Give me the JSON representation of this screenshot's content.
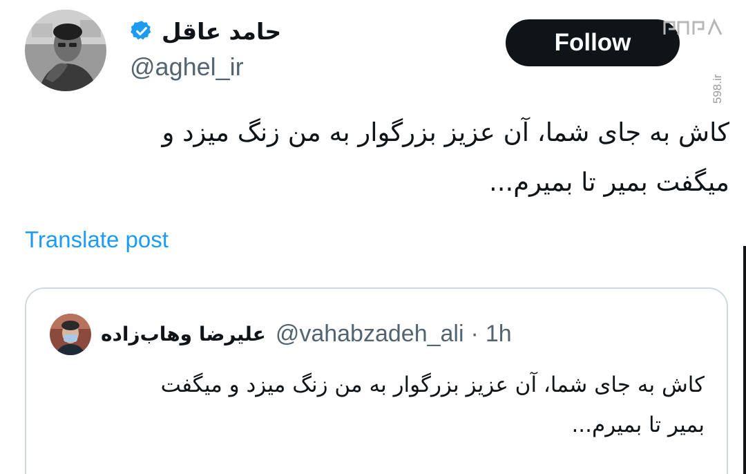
{
  "author": {
    "display_name": "حامد عاقل",
    "handle": "@aghel_ir",
    "verified": true,
    "avatar_icon": "avatar-photo-icon",
    "verified_icon": "verified-badge-icon"
  },
  "follow_button": {
    "label": "Follow"
  },
  "post": {
    "text_line1": "کاش به جای شما، آن عزیز بزرگوار به من زنگ میزد و",
    "text_line2": "میگفت بمیر تا بمیرم..."
  },
  "translate": {
    "label": "Translate post"
  },
  "quoted_post": {
    "display_name": "علیرضا وهاب‌زاده",
    "handle": "@vahabzadeh_ali",
    "separator": "·",
    "time": "1h",
    "text_line1": "کاش به جای شما، آن عزیز بزرگوار به من زنگ میزد و میگفت",
    "text_line2": "بمیر تا بمیرم..."
  },
  "watermark": {
    "vertical_text": "598.ir"
  },
  "colors": {
    "text_primary": "#0f1419",
    "text_secondary": "#536471",
    "link": "#1d9bf0",
    "verified": "#1d9bf0",
    "border": "#cfd9de"
  }
}
